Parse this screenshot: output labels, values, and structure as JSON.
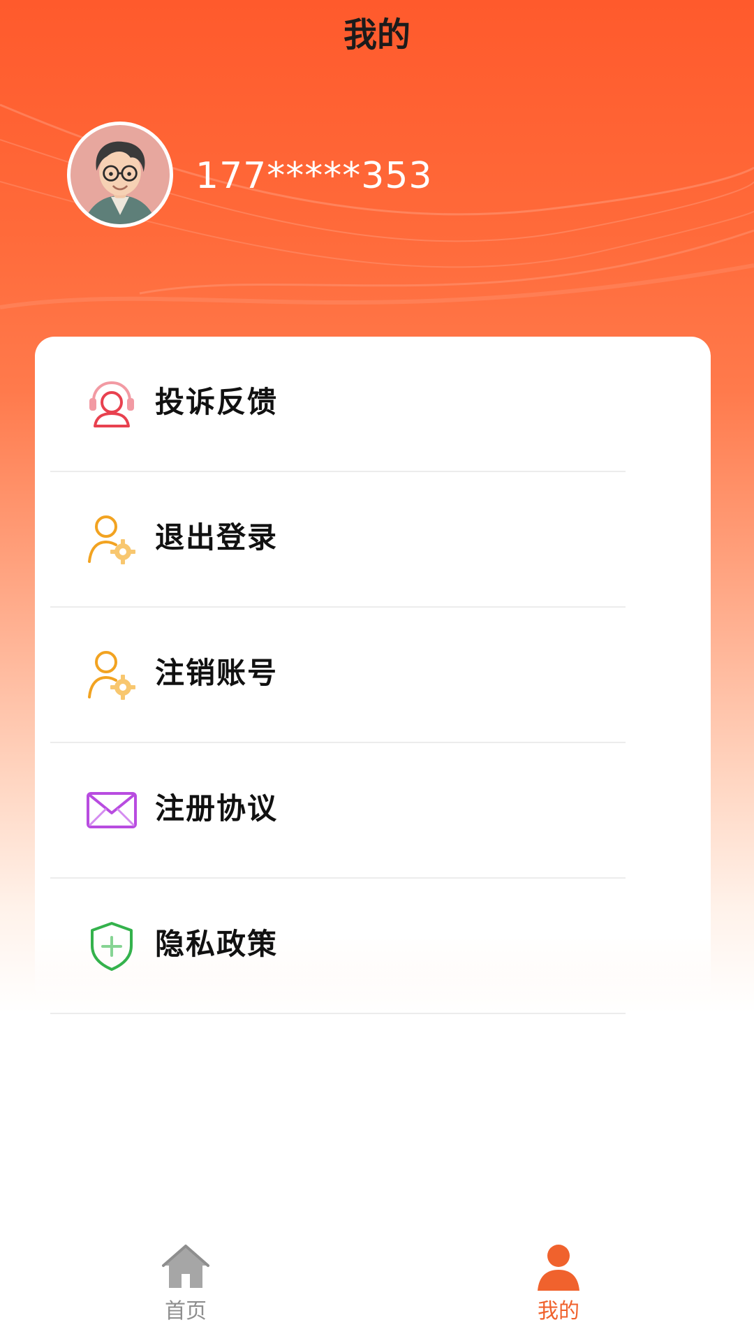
{
  "header": {
    "title": "我的"
  },
  "profile": {
    "phone": "177*****353",
    "avatar_icon": "avatar-portrait-icon"
  },
  "menu": {
    "items": [
      {
        "label": "投诉反馈",
        "icon": "headset-user-icon",
        "icon_color": "#E8414F"
      },
      {
        "label": "退出登录",
        "icon": "user-gear-icon",
        "icon_color": "#F2A321"
      },
      {
        "label": "注销账号",
        "icon": "user-gear-icon",
        "icon_color": "#F2A321"
      },
      {
        "label": "注册协议",
        "icon": "envelope-icon",
        "icon_color": "#B84CE0"
      },
      {
        "label": "隐私政策",
        "icon": "shield-plus-icon",
        "icon_color": "#34B24C"
      }
    ]
  },
  "tabbar": {
    "tabs": [
      {
        "label": "首页",
        "icon": "home-icon",
        "active": false,
        "color": "#8E8E8E"
      },
      {
        "label": "我的",
        "icon": "person-icon",
        "active": true,
        "color": "#F0622D"
      }
    ]
  },
  "theme": {
    "accent": "#FF5A2C",
    "text": "#111111"
  }
}
